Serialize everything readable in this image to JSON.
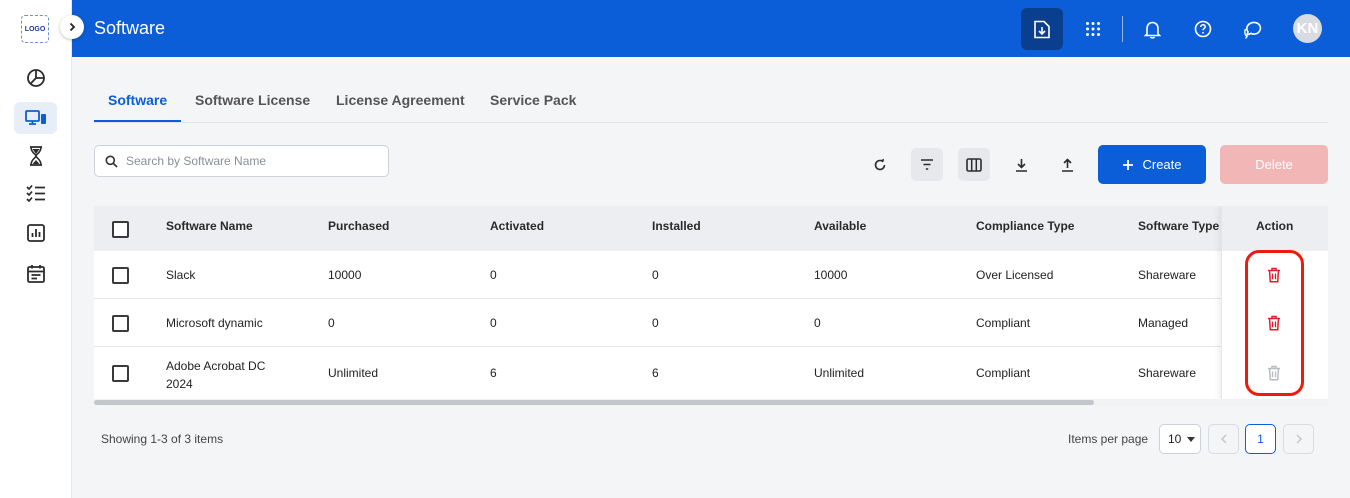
{
  "brand": {
    "logo_text": "LOGO",
    "accent": "#0b5ed7",
    "danger": "#e11d2b"
  },
  "header": {
    "title": "Software",
    "avatar_initials": "KN"
  },
  "sidebar": {
    "items": [
      {
        "icon": "pie-chart-icon"
      },
      {
        "icon": "devices-icon",
        "active": true
      },
      {
        "icon": "hourglass-icon"
      },
      {
        "icon": "checklist-icon"
      },
      {
        "icon": "bar-report-icon"
      },
      {
        "icon": "calendar-icon"
      }
    ]
  },
  "tabs": [
    {
      "label": "Software",
      "active": true
    },
    {
      "label": "Software License"
    },
    {
      "label": "License Agreement"
    },
    {
      "label": "Service Pack"
    }
  ],
  "search": {
    "placeholder": "Search by Software Name",
    "value": ""
  },
  "toolbar": {
    "create_label": "Create",
    "delete_label": "Delete"
  },
  "table": {
    "columns": [
      "Software Name",
      "Purchased",
      "Activated",
      "Installed",
      "Available",
      "Compliance Type",
      "Software Type",
      "Action"
    ],
    "rows": [
      {
        "name": "Slack",
        "purchased": "10000",
        "activated": "0",
        "installed": "0",
        "available": "10000",
        "compliance": "Over Licensed",
        "type": "Shareware",
        "delete_enabled": true
      },
      {
        "name": "Microsoft dynamic",
        "purchased": "0",
        "activated": "0",
        "installed": "0",
        "available": "0",
        "compliance": "Compliant",
        "type": "Managed",
        "delete_enabled": true
      },
      {
        "name": "Adobe Acrobat DC 2024",
        "purchased": "Unlimited",
        "activated": "6",
        "installed": "6",
        "available": "Unlimited",
        "compliance": "Compliant",
        "type": "Shareware",
        "delete_enabled": false
      }
    ]
  },
  "footer": {
    "showing": "Showing 1-3 of 3 items",
    "items_per_page_label": "Items per page",
    "items_per_page_value": "10",
    "current_page": "1"
  }
}
